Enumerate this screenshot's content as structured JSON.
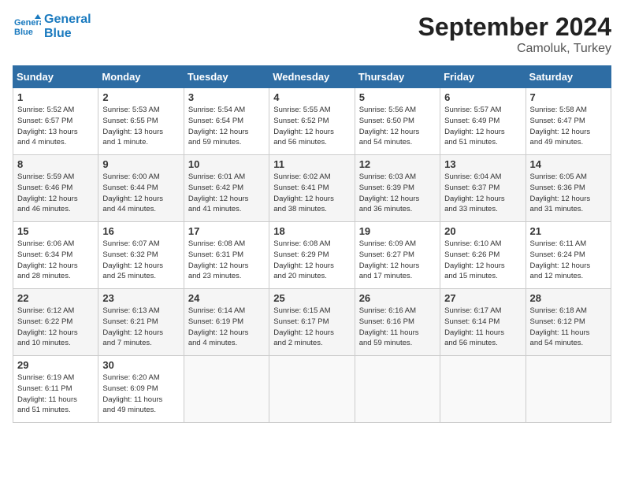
{
  "header": {
    "logo_line1": "General",
    "logo_line2": "Blue",
    "month_title": "September 2024",
    "location": "Camoluk, Turkey"
  },
  "days_of_week": [
    "Sunday",
    "Monday",
    "Tuesday",
    "Wednesday",
    "Thursday",
    "Friday",
    "Saturday"
  ],
  "weeks": [
    [
      {
        "day": "1",
        "info": "Sunrise: 5:52 AM\nSunset: 6:57 PM\nDaylight: 13 hours\nand 4 minutes."
      },
      {
        "day": "2",
        "info": "Sunrise: 5:53 AM\nSunset: 6:55 PM\nDaylight: 13 hours\nand 1 minute."
      },
      {
        "day": "3",
        "info": "Sunrise: 5:54 AM\nSunset: 6:54 PM\nDaylight: 12 hours\nand 59 minutes."
      },
      {
        "day": "4",
        "info": "Sunrise: 5:55 AM\nSunset: 6:52 PM\nDaylight: 12 hours\nand 56 minutes."
      },
      {
        "day": "5",
        "info": "Sunrise: 5:56 AM\nSunset: 6:50 PM\nDaylight: 12 hours\nand 54 minutes."
      },
      {
        "day": "6",
        "info": "Sunrise: 5:57 AM\nSunset: 6:49 PM\nDaylight: 12 hours\nand 51 minutes."
      },
      {
        "day": "7",
        "info": "Sunrise: 5:58 AM\nSunset: 6:47 PM\nDaylight: 12 hours\nand 49 minutes."
      }
    ],
    [
      {
        "day": "8",
        "info": "Sunrise: 5:59 AM\nSunset: 6:46 PM\nDaylight: 12 hours\nand 46 minutes."
      },
      {
        "day": "9",
        "info": "Sunrise: 6:00 AM\nSunset: 6:44 PM\nDaylight: 12 hours\nand 44 minutes."
      },
      {
        "day": "10",
        "info": "Sunrise: 6:01 AM\nSunset: 6:42 PM\nDaylight: 12 hours\nand 41 minutes."
      },
      {
        "day": "11",
        "info": "Sunrise: 6:02 AM\nSunset: 6:41 PM\nDaylight: 12 hours\nand 38 minutes."
      },
      {
        "day": "12",
        "info": "Sunrise: 6:03 AM\nSunset: 6:39 PM\nDaylight: 12 hours\nand 36 minutes."
      },
      {
        "day": "13",
        "info": "Sunrise: 6:04 AM\nSunset: 6:37 PM\nDaylight: 12 hours\nand 33 minutes."
      },
      {
        "day": "14",
        "info": "Sunrise: 6:05 AM\nSunset: 6:36 PM\nDaylight: 12 hours\nand 31 minutes."
      }
    ],
    [
      {
        "day": "15",
        "info": "Sunrise: 6:06 AM\nSunset: 6:34 PM\nDaylight: 12 hours\nand 28 minutes."
      },
      {
        "day": "16",
        "info": "Sunrise: 6:07 AM\nSunset: 6:32 PM\nDaylight: 12 hours\nand 25 minutes."
      },
      {
        "day": "17",
        "info": "Sunrise: 6:08 AM\nSunset: 6:31 PM\nDaylight: 12 hours\nand 23 minutes."
      },
      {
        "day": "18",
        "info": "Sunrise: 6:08 AM\nSunset: 6:29 PM\nDaylight: 12 hours\nand 20 minutes."
      },
      {
        "day": "19",
        "info": "Sunrise: 6:09 AM\nSunset: 6:27 PM\nDaylight: 12 hours\nand 17 minutes."
      },
      {
        "day": "20",
        "info": "Sunrise: 6:10 AM\nSunset: 6:26 PM\nDaylight: 12 hours\nand 15 minutes."
      },
      {
        "day": "21",
        "info": "Sunrise: 6:11 AM\nSunset: 6:24 PM\nDaylight: 12 hours\nand 12 minutes."
      }
    ],
    [
      {
        "day": "22",
        "info": "Sunrise: 6:12 AM\nSunset: 6:22 PM\nDaylight: 12 hours\nand 10 minutes."
      },
      {
        "day": "23",
        "info": "Sunrise: 6:13 AM\nSunset: 6:21 PM\nDaylight: 12 hours\nand 7 minutes."
      },
      {
        "day": "24",
        "info": "Sunrise: 6:14 AM\nSunset: 6:19 PM\nDaylight: 12 hours\nand 4 minutes."
      },
      {
        "day": "25",
        "info": "Sunrise: 6:15 AM\nSunset: 6:17 PM\nDaylight: 12 hours\nand 2 minutes."
      },
      {
        "day": "26",
        "info": "Sunrise: 6:16 AM\nSunset: 6:16 PM\nDaylight: 11 hours\nand 59 minutes."
      },
      {
        "day": "27",
        "info": "Sunrise: 6:17 AM\nSunset: 6:14 PM\nDaylight: 11 hours\nand 56 minutes."
      },
      {
        "day": "28",
        "info": "Sunrise: 6:18 AM\nSunset: 6:12 PM\nDaylight: 11 hours\nand 54 minutes."
      }
    ],
    [
      {
        "day": "29",
        "info": "Sunrise: 6:19 AM\nSunset: 6:11 PM\nDaylight: 11 hours\nand 51 minutes."
      },
      {
        "day": "30",
        "info": "Sunrise: 6:20 AM\nSunset: 6:09 PM\nDaylight: 11 hours\nand 49 minutes."
      },
      {
        "day": "",
        "info": ""
      },
      {
        "day": "",
        "info": ""
      },
      {
        "day": "",
        "info": ""
      },
      {
        "day": "",
        "info": ""
      },
      {
        "day": "",
        "info": ""
      }
    ]
  ]
}
